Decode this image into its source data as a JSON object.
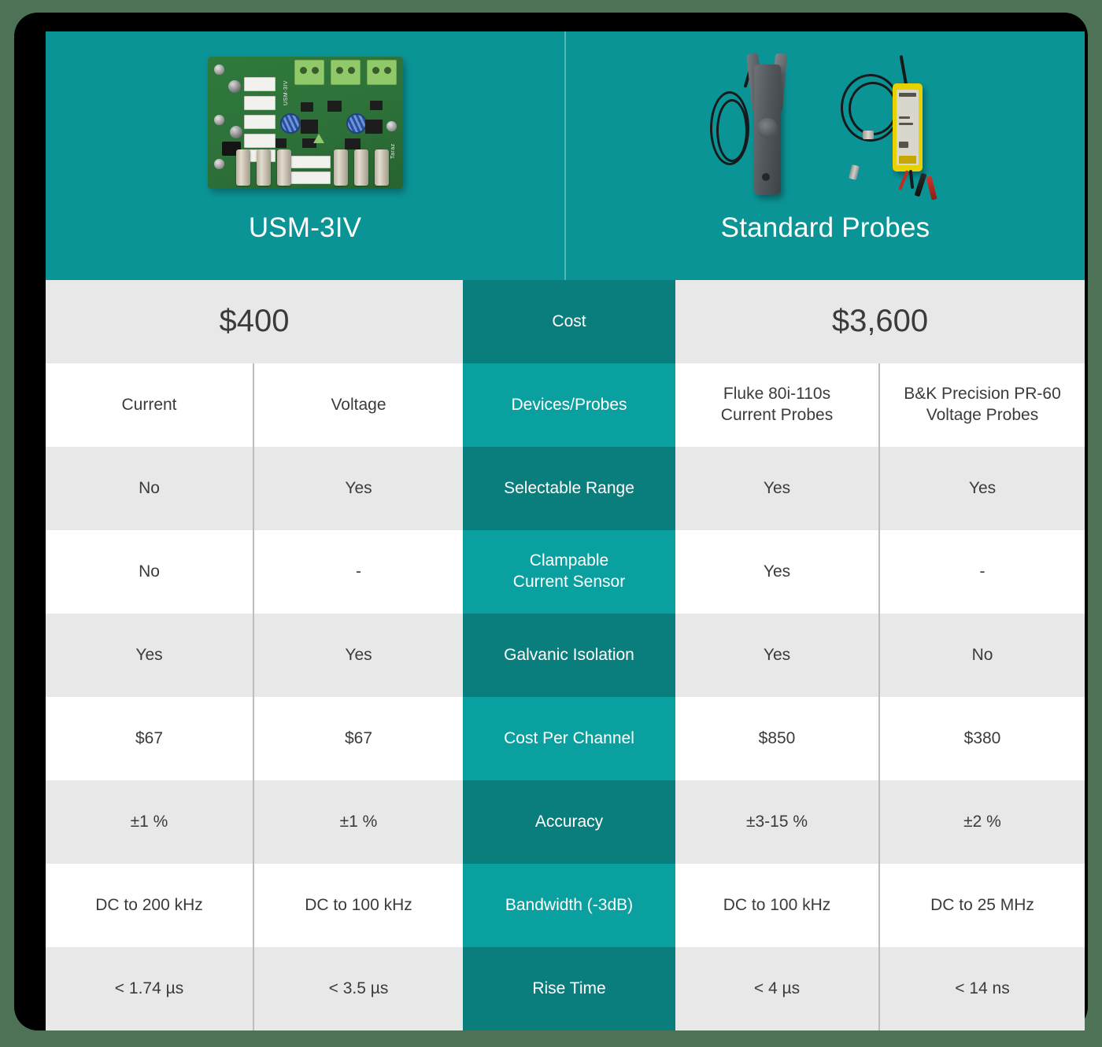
{
  "page": {
    "background_color": "#4d7256",
    "frame_color": "#000000"
  },
  "theme": {
    "header_teal": "#0b9496",
    "center_teal_dark": "#0a7e7d",
    "center_teal_light": "#0ba0a0",
    "row_grey": "#e8e8e8",
    "row_white": "#ffffff",
    "text_dark": "#3b3b3b",
    "text_light": "#ffffff",
    "divider_grey": "#bdbdbd"
  },
  "header": {
    "left": {
      "title": "USM-3IV",
      "image": "circuit-board-photo"
    },
    "right": {
      "title": "Standard Probes",
      "image": "probes-photo"
    }
  },
  "table": {
    "rows": [
      {
        "label": "Cost",
        "label_shade": "dark",
        "row_shade": "grey",
        "left_span": true,
        "right_span": true,
        "left": [
          "$400"
        ],
        "right": [
          "$3,600"
        ],
        "size": "price"
      },
      {
        "label": "Devices/Probes",
        "label_shade": "light",
        "row_shade": "white",
        "left_span": false,
        "right_span": false,
        "left": [
          "Current",
          "Voltage"
        ],
        "right": [
          "Fluke 80i-110s\nCurrent Probes",
          "B&K Precision PR-60\nVoltage Probes"
        ],
        "size": "normal"
      },
      {
        "label": "Selectable Range",
        "label_shade": "dark",
        "row_shade": "grey",
        "left_span": false,
        "right_span": false,
        "left": [
          "No",
          "Yes"
        ],
        "right": [
          "Yes",
          "Yes"
        ],
        "size": "normal"
      },
      {
        "label": "Clampable\nCurrent Sensor",
        "label_shade": "light",
        "row_shade": "white",
        "left_span": false,
        "right_span": false,
        "left": [
          "No",
          "-"
        ],
        "right": [
          "Yes",
          "-"
        ],
        "size": "normal"
      },
      {
        "label": "Galvanic Isolation",
        "label_shade": "dark",
        "row_shade": "grey",
        "left_span": false,
        "right_span": false,
        "left": [
          "Yes",
          "Yes"
        ],
        "right": [
          "Yes",
          "No"
        ],
        "size": "normal"
      },
      {
        "label": "Cost Per Channel",
        "label_shade": "light",
        "row_shade": "white",
        "left_span": false,
        "right_span": false,
        "left": [
          "$67",
          "$67"
        ],
        "right": [
          "$850",
          "$380"
        ],
        "size": "normal"
      },
      {
        "label": "Accuracy",
        "label_shade": "dark",
        "row_shade": "grey",
        "left_span": false,
        "right_span": false,
        "left": [
          "±1 %",
          "±1 %"
        ],
        "right": [
          "±3-15 %",
          "±2 %"
        ],
        "size": "normal"
      },
      {
        "label": "Bandwidth (-3dB)",
        "label_shade": "light",
        "row_shade": "white",
        "left_span": false,
        "right_span": false,
        "left": [
          "DC to 200 kHz",
          "DC to 100 kHz"
        ],
        "right": [
          "DC to 100 kHz",
          "DC to 25 MHz"
        ],
        "size": "normal"
      },
      {
        "label": "Rise Time",
        "label_shade": "dark",
        "row_shade": "grey",
        "left_span": false,
        "right_span": false,
        "left": [
          "< 1.74 µs",
          "< 3.5 µs"
        ],
        "right": [
          "< 4 µs",
          "< 14 ns"
        ],
        "size": "normal"
      }
    ]
  }
}
